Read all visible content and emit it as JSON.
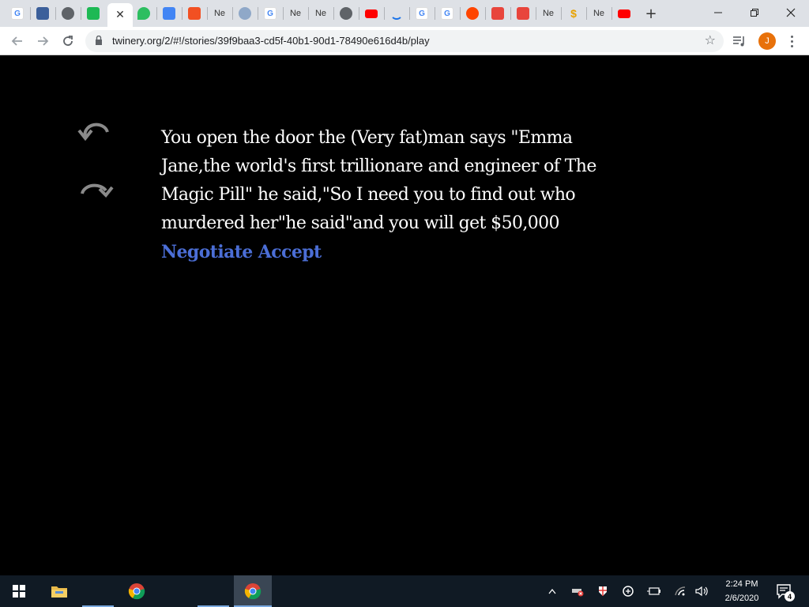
{
  "browser": {
    "tabs": [
      {
        "icon": "google-icon",
        "letter": "G",
        "color": "#4285f4"
      },
      {
        "icon": "site-icon",
        "letter": "",
        "color": "#3b5f9a"
      },
      {
        "icon": "globe-icon",
        "letter": "",
        "color": "#5f6368"
      },
      {
        "icon": "green-flag-icon",
        "letter": "",
        "color": "#1db954"
      },
      {
        "icon": "active",
        "letter": "",
        "color": ""
      },
      {
        "icon": "evernote-icon",
        "letter": "",
        "color": "#2dbe60"
      },
      {
        "icon": "docs-icon",
        "letter": "",
        "color": "#4285f4"
      },
      {
        "icon": "microsoft-icon",
        "letter": "",
        "color": "#f25022"
      },
      {
        "icon": "text-tab",
        "letter": "Ne",
        "color": ""
      },
      {
        "icon": "avatar-tab-icon",
        "letter": "",
        "color": "#8fa8c8"
      },
      {
        "icon": "google-icon",
        "letter": "G",
        "color": "#4285f4"
      },
      {
        "icon": "text-tab",
        "letter": "Ne",
        "color": ""
      },
      {
        "icon": "text-tab",
        "letter": "Ne",
        "color": ""
      },
      {
        "icon": "globe-icon",
        "letter": "",
        "color": "#5f6368"
      },
      {
        "icon": "youtube-icon",
        "letter": "",
        "color": "#ff0000"
      },
      {
        "icon": "loading-icon",
        "letter": "",
        "color": "#1a73e8"
      },
      {
        "icon": "google-icon",
        "letter": "G",
        "color": "#4285f4"
      },
      {
        "icon": "google-icon",
        "letter": "G",
        "color": "#4285f4"
      },
      {
        "icon": "reddit-icon",
        "letter": "",
        "color": "#ff4500"
      },
      {
        "icon": "store-icon",
        "letter": "",
        "color": "#e8453c"
      },
      {
        "icon": "store-icon",
        "letter": "",
        "color": "#e8453c"
      },
      {
        "icon": "text-tab",
        "letter": "Ne",
        "color": ""
      },
      {
        "icon": "dollar-icon",
        "letter": "$",
        "color": "#e8a200"
      },
      {
        "icon": "text-tab",
        "letter": "Ne",
        "color": ""
      },
      {
        "icon": "youtube-icon",
        "letter": "",
        "color": "#ff0000"
      }
    ],
    "active_tab_close": "✕",
    "new_tab": "+",
    "url": "twinery.org/2/#!/stories/39f9baa3-cd5f-40b1-90d1-78490e616d4b/play",
    "profile_initial": "J",
    "colors": {
      "profile": "#e8710a",
      "link": "#4b6ed6",
      "background": "#000000"
    }
  },
  "story": {
    "passage": "You open the door the (Very fat)man says \"Emma Jane,the world's first trillionare and engineer of The Magic Pill\" he said,\"So I need you to find out who murdered her\"he said\"and you will get $50,000",
    "links": [
      "Negotiate",
      "Accept"
    ]
  },
  "taskbar": {
    "time": "2:24 PM",
    "date": "2/6/2020",
    "notification_count": "4"
  }
}
